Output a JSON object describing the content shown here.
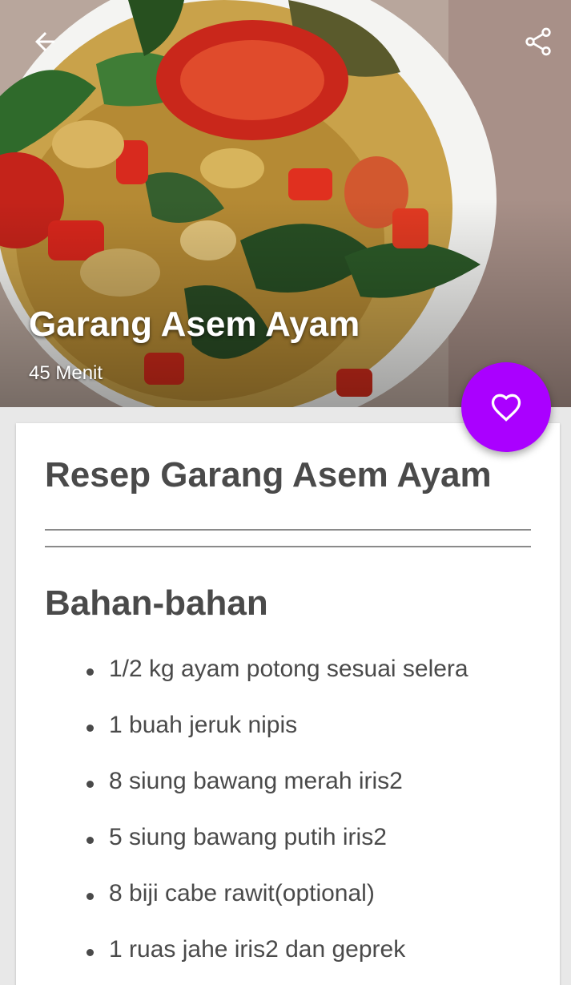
{
  "hero": {
    "title": "Garang Asem Ayam",
    "duration": "45 Menit"
  },
  "toolbar": {
    "back_icon": "arrow-left-icon",
    "share_icon": "share-icon"
  },
  "fab": {
    "icon": "heart-icon",
    "color": "#aa00ff"
  },
  "recipe": {
    "title": "Resep Garang Asem Ayam",
    "ingredients_heading": "Bahan-bahan",
    "ingredients": [
      "1/2 kg ayam potong sesuai selera",
      "1 buah jeruk nipis",
      "8 siung bawang merah iris2",
      "5 siung bawang putih iris2",
      "8 biji cabe rawit(optional)",
      "1 ruas jahe iris2 dan geprek"
    ]
  }
}
